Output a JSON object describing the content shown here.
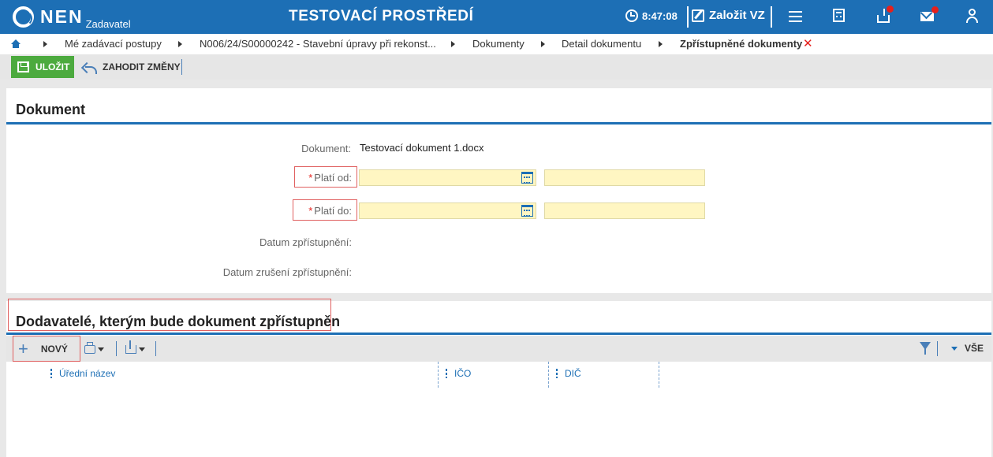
{
  "topbar": {
    "logo_text": "NEN",
    "logo_sub": "Zadavatel",
    "env_title": "TESTOVACÍ PROSTŘEDÍ",
    "time": "8:47:08",
    "create_label": "Založit VZ",
    "icons": [
      "clock-icon",
      "edit-icon",
      "menu-icon",
      "calculator-icon",
      "inbox-icon",
      "mail-icon",
      "user-icon"
    ],
    "accent": "#1d6fb5",
    "notify_color": "#e5201c"
  },
  "breadcrumb": {
    "items": [
      "Mé zadávací postupy",
      "N006/24/S00000242 - Stavební úpravy při rekonst...",
      "Dokumenty",
      "Detail dokumentu",
      "Zpřístupněné dokumenty"
    ]
  },
  "toolbar": {
    "save_label": "ULOŽIT",
    "discard_label": "ZAHODIT ZMĚNY",
    "save_color": "#4caa3e"
  },
  "document_section": {
    "title": "Dokument",
    "document_label": "Dokument:",
    "document_value": "Testovací dokument 1.docx",
    "valid_from_label": "Platí od:",
    "valid_to_label": "Platí do:",
    "required_mark": "*",
    "valid_from_date": "",
    "valid_from_time": "",
    "valid_to_date": "",
    "valid_to_time": "",
    "access_date_label": "Datum zpřístupnění:",
    "access_cancel_label": "Datum zrušení zpřístupnění:"
  },
  "suppliers_section": {
    "title": "Dodavatelé, kterým bude dokument zpřístupněn",
    "new_label": "NOVÝ",
    "filter_label": "VŠE",
    "columns": [
      "Úřední název",
      "IČO",
      "DIČ"
    ],
    "rows": []
  }
}
